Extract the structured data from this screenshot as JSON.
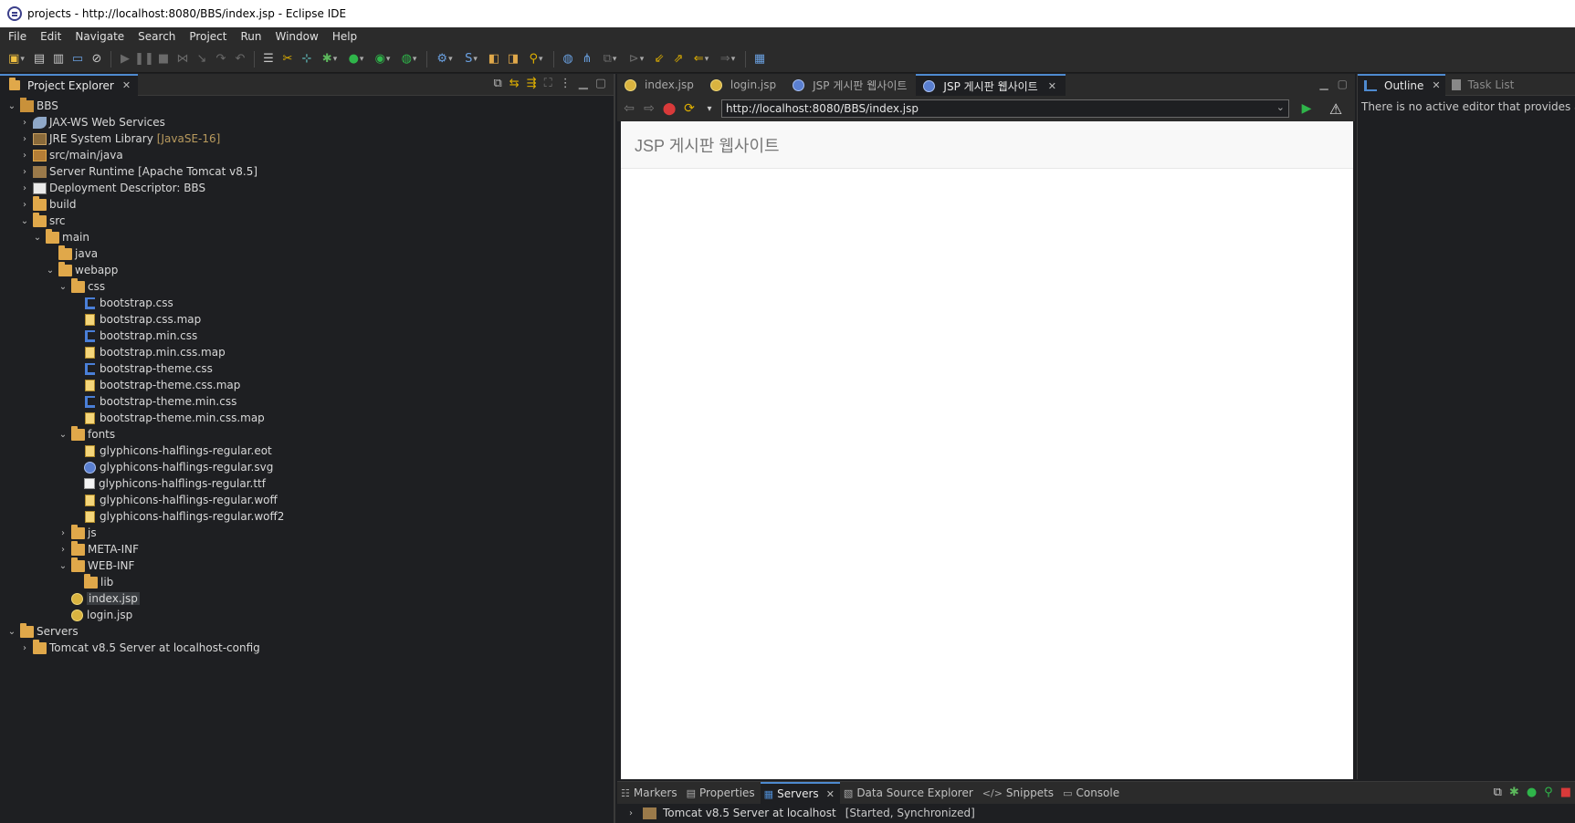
{
  "window": {
    "title": "projects - http://localhost:8080/BBS/index.jsp - Eclipse IDE"
  },
  "menu": [
    "File",
    "Edit",
    "Navigate",
    "Search",
    "Project",
    "Run",
    "Window",
    "Help"
  ],
  "project_explorer": {
    "tab_label": "Project Explorer",
    "tree": [
      {
        "depth": 0,
        "twisty": "open",
        "icon": "project-icon",
        "label": "BBS"
      },
      {
        "depth": 1,
        "twisty": "closed",
        "icon": "web-services-icon",
        "label": "JAX-WS Web Services"
      },
      {
        "depth": 1,
        "twisty": "closed",
        "icon": "library-icon",
        "label": "JRE System Library",
        "extra": "[JavaSE-16]"
      },
      {
        "depth": 1,
        "twisty": "closed",
        "icon": "source-folder-icon",
        "label": "src/main/java"
      },
      {
        "depth": 1,
        "twisty": "closed",
        "icon": "server-runtime-icon",
        "label": "Server Runtime [Apache Tomcat v8.5]"
      },
      {
        "depth": 1,
        "twisty": "closed",
        "icon": "deployment-descriptor-icon",
        "label": "Deployment Descriptor: BBS"
      },
      {
        "depth": 1,
        "twisty": "closed",
        "icon": "folder-icon",
        "label": "build"
      },
      {
        "depth": 1,
        "twisty": "open",
        "icon": "folder-icon",
        "label": "src"
      },
      {
        "depth": 2,
        "twisty": "open",
        "icon": "folder-icon",
        "label": "main"
      },
      {
        "depth": 3,
        "twisty": "none",
        "icon": "folder-icon",
        "label": "java"
      },
      {
        "depth": 3,
        "twisty": "open",
        "icon": "folder-icon",
        "label": "webapp"
      },
      {
        "depth": 4,
        "twisty": "open",
        "icon": "folder-icon",
        "label": "css"
      },
      {
        "depth": 5,
        "twisty": "none",
        "icon": "css-file-icon",
        "label": "bootstrap.css"
      },
      {
        "depth": 5,
        "twisty": "none",
        "icon": "file-icon",
        "label": "bootstrap.css.map"
      },
      {
        "depth": 5,
        "twisty": "none",
        "icon": "css-file-icon",
        "label": "bootstrap.min.css"
      },
      {
        "depth": 5,
        "twisty": "none",
        "icon": "file-icon",
        "label": "bootstrap.min.css.map"
      },
      {
        "depth": 5,
        "twisty": "none",
        "icon": "css-file-icon",
        "label": "bootstrap-theme.css"
      },
      {
        "depth": 5,
        "twisty": "none",
        "icon": "file-icon",
        "label": "bootstrap-theme.css.map"
      },
      {
        "depth": 5,
        "twisty": "none",
        "icon": "css-file-icon",
        "label": "bootstrap-theme.min.css"
      },
      {
        "depth": 5,
        "twisty": "none",
        "icon": "file-icon",
        "label": "bootstrap-theme.min.css.map"
      },
      {
        "depth": 4,
        "twisty": "open",
        "icon": "folder-icon",
        "label": "fonts"
      },
      {
        "depth": 5,
        "twisty": "none",
        "icon": "file-icon",
        "label": "glyphicons-halflings-regular.eot"
      },
      {
        "depth": 5,
        "twisty": "none",
        "icon": "svg-file-icon",
        "label": "glyphicons-halflings-regular.svg"
      },
      {
        "depth": 5,
        "twisty": "none",
        "icon": "font-file-icon",
        "label": "glyphicons-halflings-regular.ttf"
      },
      {
        "depth": 5,
        "twisty": "none",
        "icon": "file-icon",
        "label": "glyphicons-halflings-regular.woff"
      },
      {
        "depth": 5,
        "twisty": "none",
        "icon": "file-icon",
        "label": "glyphicons-halflings-regular.woff2"
      },
      {
        "depth": 4,
        "twisty": "closed",
        "icon": "folder-icon",
        "label": "js"
      },
      {
        "depth": 4,
        "twisty": "closed",
        "icon": "folder-icon",
        "label": "META-INF"
      },
      {
        "depth": 4,
        "twisty": "open",
        "icon": "folder-icon",
        "label": "WEB-INF"
      },
      {
        "depth": 5,
        "twisty": "none",
        "icon": "folder-icon",
        "label": "lib"
      },
      {
        "depth": 4,
        "twisty": "none",
        "icon": "jsp-file-icon",
        "label": "index.jsp",
        "selected": true
      },
      {
        "depth": 4,
        "twisty": "none",
        "icon": "jsp-file-icon",
        "label": "login.jsp"
      },
      {
        "depth": 0,
        "twisty": "open",
        "icon": "folder-icon",
        "label": "Servers"
      },
      {
        "depth": 1,
        "twisty": "closed",
        "icon": "folder-icon",
        "label": "Tomcat v8.5 Server at localhost-config"
      }
    ]
  },
  "editor": {
    "tabs": [
      {
        "label": "index.jsp",
        "icon": "jsp-file-icon",
        "active": false
      },
      {
        "label": "login.jsp",
        "icon": "jsp-file-icon",
        "active": false
      },
      {
        "label": "JSP 게시판 웹사이트",
        "icon": "browser-icon",
        "active": false
      },
      {
        "label": "JSP 게시판 웹사이트",
        "icon": "browser-icon",
        "active": true
      }
    ],
    "url": "http://localhost:8080/BBS/index.jsp"
  },
  "webpage": {
    "brand": "JSP 게시판 웹사이트"
  },
  "outline": {
    "tab_label": "Outline",
    "tasklist_label": "Task List",
    "message": "There is no active editor that provides an outline."
  },
  "bottom": {
    "tabs": [
      {
        "label": "Markers",
        "active": false
      },
      {
        "label": "Properties",
        "active": false
      },
      {
        "label": "Servers",
        "active": true
      },
      {
        "label": "Data Source Explorer",
        "active": false
      },
      {
        "label": "Snippets",
        "active": false
      },
      {
        "label": "Console",
        "active": false
      }
    ],
    "server": {
      "name": "Tomcat v8.5 Server at localhost",
      "status": "[Started, Synchronized]"
    }
  },
  "colors": {
    "accent": "#4e8ad0",
    "folder": "#e0a84a",
    "run_green": "#2fb54a",
    "stop_red": "#d93a3a"
  }
}
